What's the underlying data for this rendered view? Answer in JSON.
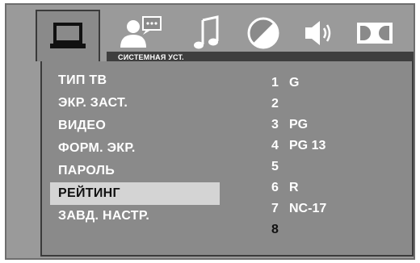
{
  "tabs": [
    {
      "icon": "tv-icon",
      "active": true
    },
    {
      "icon": "person-speech-icon",
      "active": false
    },
    {
      "icon": "music-note-icon",
      "active": false
    },
    {
      "icon": "contrast-icon",
      "active": false
    },
    {
      "icon": "speaker-icon",
      "active": false
    },
    {
      "icon": "dolby-icon",
      "active": false
    }
  ],
  "section_label": "СИСТЕМНАЯ УСТ.",
  "menu": {
    "items": [
      {
        "label": "ТИП ТВ"
      },
      {
        "label": "ЭКР. ЗАСТ."
      },
      {
        "label": "ВИДЕО"
      },
      {
        "label": "ФОРМ. ЭКР."
      },
      {
        "label": "ПАРОЛЬ"
      },
      {
        "label": "РЕЙТИНГ"
      },
      {
        "label": "ЗАВД. НАСТР."
      }
    ],
    "selected_index": 5
  },
  "ratings": {
    "items": [
      {
        "num": "1",
        "label": "G"
      },
      {
        "num": "2",
        "label": ""
      },
      {
        "num": "3",
        "label": "PG"
      },
      {
        "num": "4",
        "label": "PG 13"
      },
      {
        "num": "5",
        "label": ""
      },
      {
        "num": "6",
        "label": "R"
      },
      {
        "num": "7",
        "label": "NC-17"
      },
      {
        "num": "8",
        "label": ""
      }
    ],
    "current_index": 7
  },
  "colors": {
    "background": "#9a9a9a",
    "panel": "#8a8a8a",
    "label_bar": "#3e3e3e",
    "selected": "#d4d4d4",
    "text": "#ffffff"
  }
}
